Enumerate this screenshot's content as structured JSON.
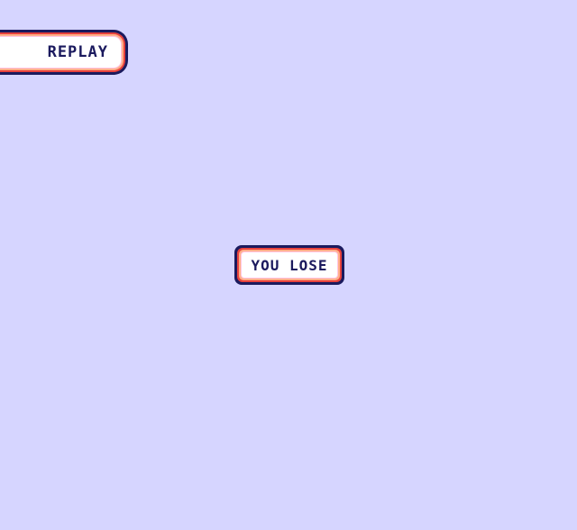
{
  "game": {
    "replay_label": "REPLAY",
    "result_text": "YOU LOSE"
  },
  "colors": {
    "background": "#d6d5ff",
    "frame_outline": "#1b1a5e",
    "frame_red": "#e8423c",
    "frame_peach": "#ffb08a",
    "frame_pink": "#ffc6e4",
    "button_fill": "#ffffff",
    "text": "#1b1a5e"
  }
}
